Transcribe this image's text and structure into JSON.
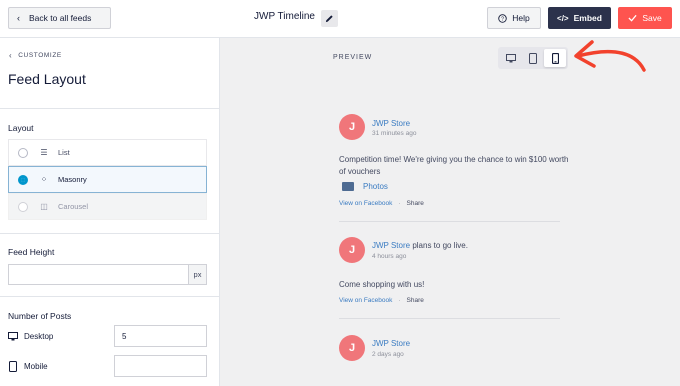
{
  "topbar": {
    "back_label": "Back to all feeds",
    "feed_title": "JWP Timeline",
    "help_label": "Help",
    "embed_label": "Embed",
    "save_label": "Save"
  },
  "sidebar": {
    "breadcrumb": "CUSTOMIZE",
    "title": "Feed Layout",
    "layout_label": "Layout",
    "layout_options": [
      {
        "label": "List",
        "icon": "list-icon",
        "state": "unselected"
      },
      {
        "label": "Masonry",
        "icon": "grid-icon",
        "state": "selected"
      },
      {
        "label": "Carousel",
        "icon": "carousel-icon",
        "state": "disabled"
      }
    ],
    "feed_height_label": "Feed Height",
    "feed_height_value": "",
    "feed_height_unit": "px",
    "num_posts_label": "Number of Posts",
    "desktop_label": "Desktop",
    "desktop_value": "5",
    "mobile_label": "Mobile",
    "mobile_value": ""
  },
  "preview": {
    "label": "PREVIEW",
    "active_device": "mobile",
    "posts": [
      {
        "avatar": "J",
        "author": "JWP Store",
        "verb": "",
        "time": "31 minutes ago",
        "text": "Competition time! We're giving you the chance to win $100 worth of vouchers",
        "attachment": "Photos",
        "view_link": "View on Facebook",
        "share_link": "Share"
      },
      {
        "avatar": "J",
        "author": "JWP Store",
        "verb": "plans to go live.",
        "time": "4 hours ago",
        "text": "Come shopping with us!",
        "attachment": "",
        "view_link": "View on Facebook",
        "share_link": "Share"
      },
      {
        "avatar": "J",
        "author": "JWP Store",
        "verb": "",
        "time": "2 days ago",
        "text": "",
        "attachment": "",
        "view_link": "",
        "share_link": ""
      }
    ]
  },
  "colors": {
    "accent_blue": "#0096cc",
    "embed_bg": "#2c324c",
    "save_bg": "#fe544f",
    "avatar_bg": "#f0767a",
    "link_blue": "#3b7cc2",
    "annotation_arrow": "#f2422d"
  }
}
